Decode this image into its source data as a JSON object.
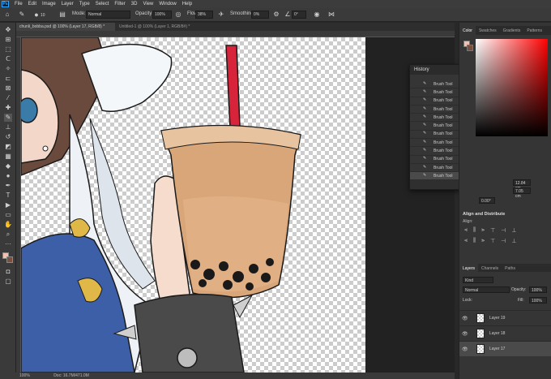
{
  "menu": {
    "app_icon": "Ps",
    "items": [
      "File",
      "Edit",
      "Image",
      "Layer",
      "Type",
      "Select",
      "Filter",
      "3D",
      "View",
      "Window",
      "Help"
    ]
  },
  "options": {
    "brush_size": "10",
    "mode_label": "Mode:",
    "mode_value": "Normal",
    "opacity_label": "Opacity:",
    "opacity_value": "100%",
    "flow_label": "Flow:",
    "flow_value": "38%",
    "smoothing_label": "Smoothing:",
    "smoothing_value": "0%",
    "angle_value": "0°"
  },
  "tabs": [
    {
      "label": "chunli_bobba.psd @ 100% (Layer 17, RGB/8) *",
      "active": true
    },
    {
      "label": "Untitled-1 @ 100% (Layer 1, RGB/8#) *",
      "active": false
    }
  ],
  "status": {
    "zoom": "100%",
    "doc": "Doc: 16.7M/471.0M"
  },
  "history": {
    "title": "History",
    "items": [
      "Brush Tool",
      "Brush Tool",
      "Brush Tool",
      "Brush Tool",
      "Brush Tool",
      "Brush Tool",
      "Brush Tool",
      "Brush Tool",
      "Brush Tool",
      "Brush Tool",
      "Brush Tool",
      "Brush Tool"
    ],
    "selected_index": 11
  },
  "color_panel": {
    "tabs": [
      "Color",
      "Swatches",
      "Gradients",
      "Patterns"
    ],
    "active_tab": "Color",
    "fg_color": "#f1c2b0",
    "bg_color": "#7a4f3e"
  },
  "properties": {
    "w": "12.84 cm",
    "h": "7.05 cm",
    "angle": "0.00°",
    "align_title": "Align and Distribute",
    "align_label": "Align:"
  },
  "layers": {
    "tabs": [
      "Layers",
      "Channels",
      "Paths"
    ],
    "active_tab": "Layers",
    "kind_label": "Kind",
    "blend_mode": "Normal",
    "opacity_label": "Opacity:",
    "opacity_value": "100%",
    "lock_label": "Lock:",
    "fill_label": "Fill:",
    "fill_value": "100%",
    "items": [
      {
        "name": "Layer 19",
        "selected": false
      },
      {
        "name": "Layer 18",
        "selected": false
      },
      {
        "name": "Layer 17",
        "selected": true
      }
    ]
  }
}
